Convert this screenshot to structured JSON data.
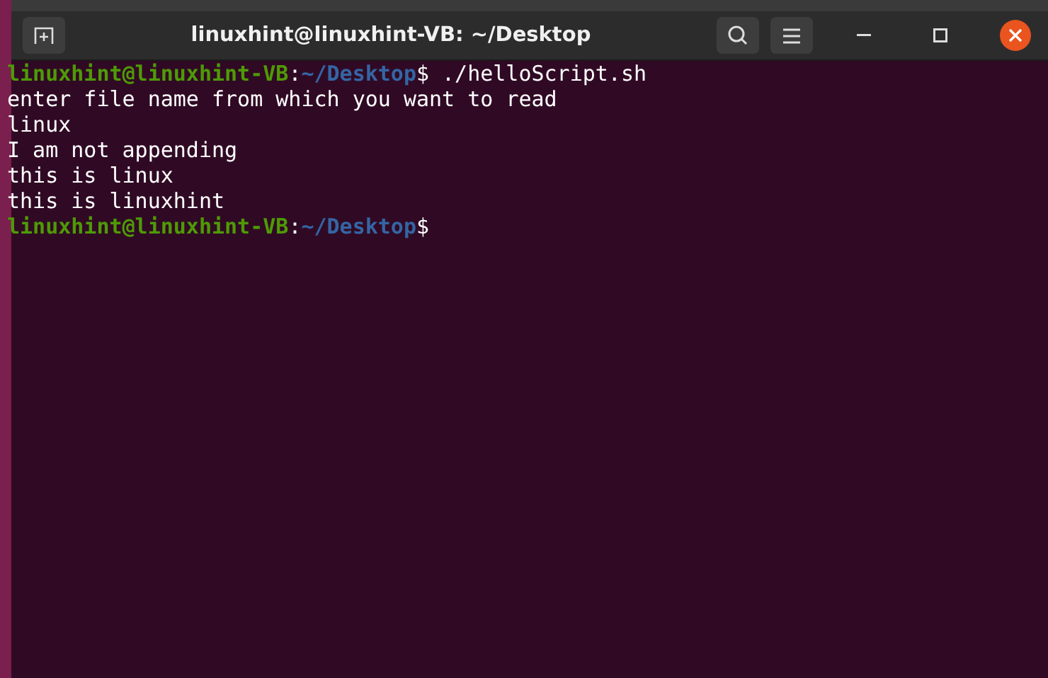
{
  "window": {
    "title": "linuxhint@linuxhint-VB: ~/Desktop"
  },
  "terminal": {
    "lines": [
      {
        "kind": "prompt",
        "user": "linuxhint@linuxhint-VB",
        "separator": ":",
        "path": "~/Desktop",
        "symbol": "$",
        "command": "./helloScript.sh"
      },
      {
        "kind": "output",
        "text": "enter file name from which you want to read"
      },
      {
        "kind": "output",
        "text": "linux"
      },
      {
        "kind": "output",
        "text": "I am not appending"
      },
      {
        "kind": "output",
        "text": "this is linux"
      },
      {
        "kind": "output",
        "text": "this is linuxhint"
      },
      {
        "kind": "prompt",
        "user": "linuxhint@linuxhint-VB",
        "separator": ":",
        "path": "~/Desktop",
        "symbol": "$"
      }
    ]
  }
}
